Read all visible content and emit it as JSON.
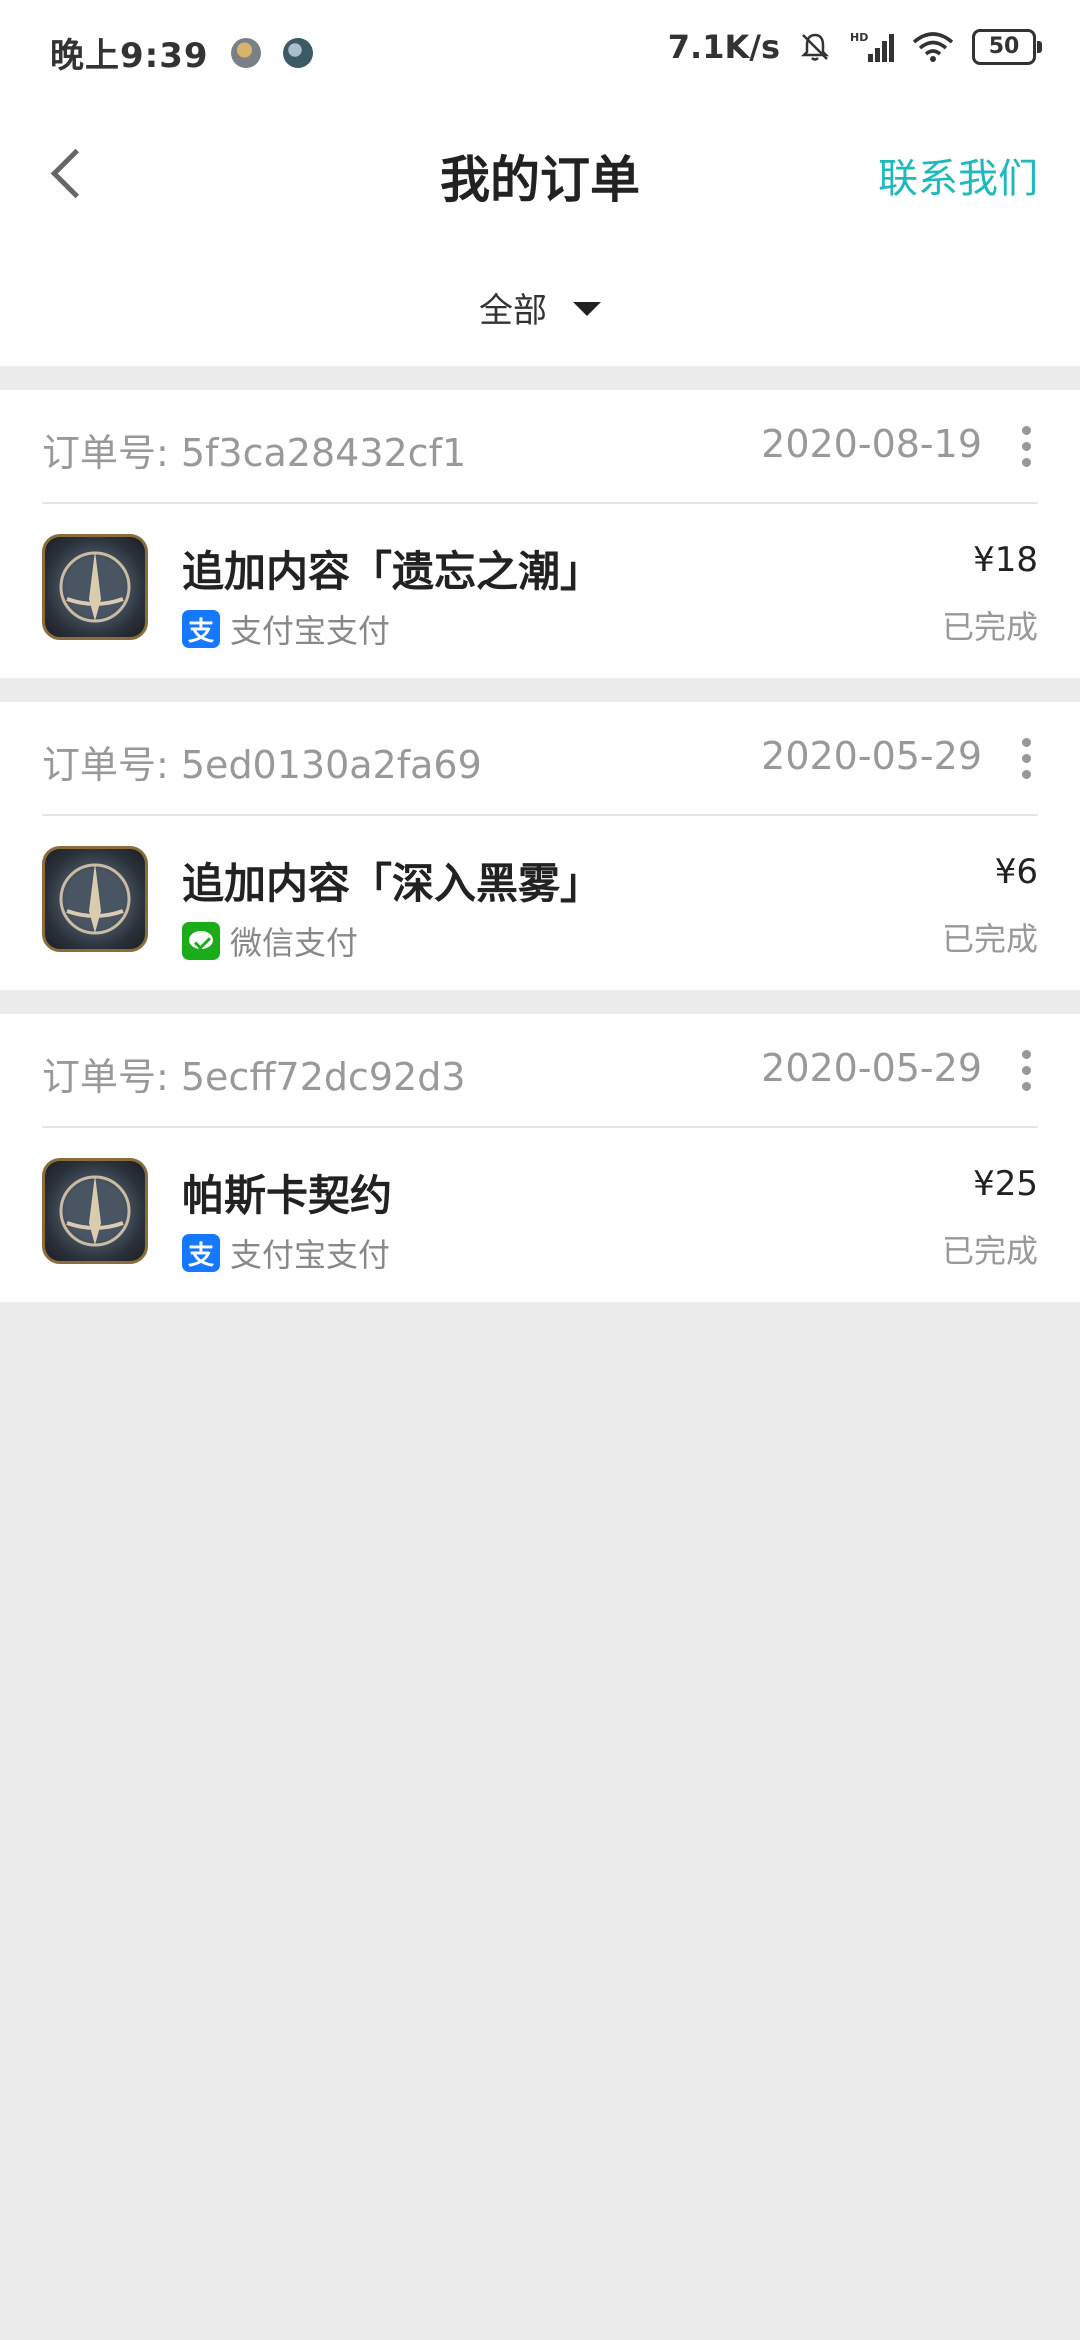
{
  "status_bar": {
    "time": "晚上9:39",
    "net_speed": "7.1K/s",
    "battery": "50"
  },
  "header": {
    "title": "我的订单",
    "contact": "联系我们"
  },
  "filter": {
    "selected": "全部"
  },
  "orders": [
    {
      "order_no": "订单号: 5f3ca28432cf1",
      "date": "2020-08-19",
      "product": "追加内容「遗忘之潮」",
      "pay_method": "支付宝支付",
      "pay_icon": "alipay-icon",
      "price": "¥18",
      "status": "已完成"
    },
    {
      "order_no": "订单号: 5ed0130a2fa69",
      "date": "2020-05-29",
      "product": "追加内容「深入黑雾」",
      "pay_method": "微信支付",
      "pay_icon": "wechat-pay-icon",
      "price": "¥6",
      "status": "已完成"
    },
    {
      "order_no": "订单号: 5ecff72dc92d3",
      "date": "2020-05-29",
      "product": "帕斯卡契约",
      "pay_method": "支付宝支付",
      "pay_icon": "alipay-icon",
      "price": "¥25",
      "status": "已完成"
    }
  ],
  "colors": {
    "accent": "#1fb9bd",
    "background": "#ececec"
  }
}
